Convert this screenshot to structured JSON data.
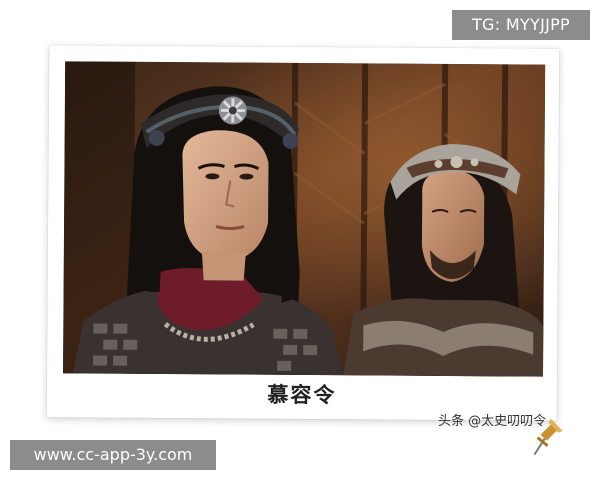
{
  "watermark_top": "TG: MYYJJPP",
  "photo": {
    "caption": "慕容令"
  },
  "credit": "头条 @太史叨叨令",
  "watermark_bottom": "www.cc-app-3y.com",
  "colors": {
    "badge_bg": "#8c8c8c",
    "badge_text": "#ffffff",
    "caption_text": "#222222",
    "pin": "#c8922e"
  },
  "icons": [
    "pushpin-icon"
  ]
}
